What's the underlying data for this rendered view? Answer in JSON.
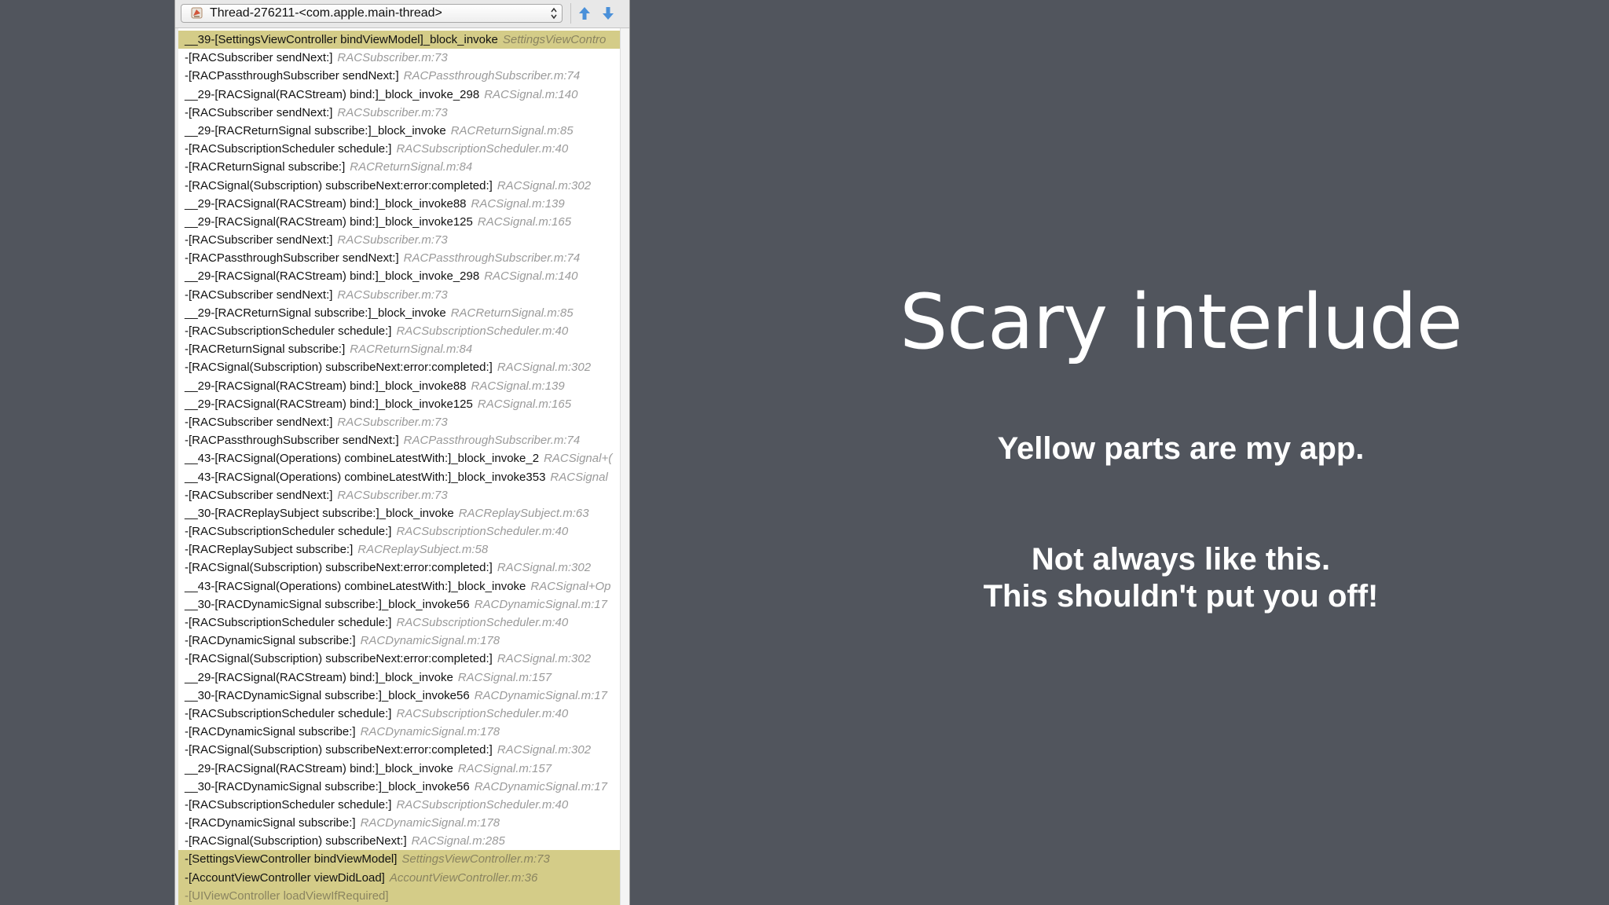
{
  "debugger": {
    "thread_label": "Thread-276211-<com.apple.main-thread>",
    "frames": [
      {
        "fn": "__39-[SettingsViewController bindViewModel]_block_invoke",
        "loc": "SettingsViewContro",
        "app": true
      },
      {
        "fn": "-[RACSubscriber sendNext:]",
        "loc": "RACSubscriber.m:73",
        "app": false
      },
      {
        "fn": "-[RACPassthroughSubscriber sendNext:]",
        "loc": "RACPassthroughSubscriber.m:74",
        "app": false
      },
      {
        "fn": "__29-[RACSignal(RACStream) bind:]_block_invoke_298",
        "loc": "RACSignal.m:140",
        "app": false
      },
      {
        "fn": "-[RACSubscriber sendNext:]",
        "loc": "RACSubscriber.m:73",
        "app": false
      },
      {
        "fn": "__29-[RACReturnSignal subscribe:]_block_invoke",
        "loc": "RACReturnSignal.m:85",
        "app": false
      },
      {
        "fn": "-[RACSubscriptionScheduler schedule:]",
        "loc": "RACSubscriptionScheduler.m:40",
        "app": false
      },
      {
        "fn": "-[RACReturnSignal subscribe:]",
        "loc": "RACReturnSignal.m:84",
        "app": false
      },
      {
        "fn": "-[RACSignal(Subscription) subscribeNext:error:completed:]",
        "loc": "RACSignal.m:302",
        "app": false
      },
      {
        "fn": "__29-[RACSignal(RACStream) bind:]_block_invoke88",
        "loc": "RACSignal.m:139",
        "app": false
      },
      {
        "fn": "__29-[RACSignal(RACStream) bind:]_block_invoke125",
        "loc": "RACSignal.m:165",
        "app": false
      },
      {
        "fn": "-[RACSubscriber sendNext:]",
        "loc": "RACSubscriber.m:73",
        "app": false
      },
      {
        "fn": "-[RACPassthroughSubscriber sendNext:]",
        "loc": "RACPassthroughSubscriber.m:74",
        "app": false
      },
      {
        "fn": "__29-[RACSignal(RACStream) bind:]_block_invoke_298",
        "loc": "RACSignal.m:140",
        "app": false
      },
      {
        "fn": "-[RACSubscriber sendNext:]",
        "loc": "RACSubscriber.m:73",
        "app": false
      },
      {
        "fn": "__29-[RACReturnSignal subscribe:]_block_invoke",
        "loc": "RACReturnSignal.m:85",
        "app": false
      },
      {
        "fn": "-[RACSubscriptionScheduler schedule:]",
        "loc": "RACSubscriptionScheduler.m:40",
        "app": false
      },
      {
        "fn": "-[RACReturnSignal subscribe:]",
        "loc": "RACReturnSignal.m:84",
        "app": false
      },
      {
        "fn": "-[RACSignal(Subscription) subscribeNext:error:completed:]",
        "loc": "RACSignal.m:302",
        "app": false
      },
      {
        "fn": "__29-[RACSignal(RACStream) bind:]_block_invoke88",
        "loc": "RACSignal.m:139",
        "app": false
      },
      {
        "fn": "__29-[RACSignal(RACStream) bind:]_block_invoke125",
        "loc": "RACSignal.m:165",
        "app": false
      },
      {
        "fn": "-[RACSubscriber sendNext:]",
        "loc": "RACSubscriber.m:73",
        "app": false
      },
      {
        "fn": "-[RACPassthroughSubscriber sendNext:]",
        "loc": "RACPassthroughSubscriber.m:74",
        "app": false
      },
      {
        "fn": "__43-[RACSignal(Operations) combineLatestWith:]_block_invoke_2",
        "loc": "RACSignal+(",
        "app": false
      },
      {
        "fn": "__43-[RACSignal(Operations) combineLatestWith:]_block_invoke353",
        "loc": "RACSignal",
        "app": false
      },
      {
        "fn": "-[RACSubscriber sendNext:]",
        "loc": "RACSubscriber.m:73",
        "app": false
      },
      {
        "fn": "__30-[RACReplaySubject subscribe:]_block_invoke",
        "loc": "RACReplaySubject.m:63",
        "app": false
      },
      {
        "fn": "-[RACSubscriptionScheduler schedule:]",
        "loc": "RACSubscriptionScheduler.m:40",
        "app": false
      },
      {
        "fn": "-[RACReplaySubject subscribe:]",
        "loc": "RACReplaySubject.m:58",
        "app": false
      },
      {
        "fn": "-[RACSignal(Subscription) subscribeNext:error:completed:]",
        "loc": "RACSignal.m:302",
        "app": false
      },
      {
        "fn": "__43-[RACSignal(Operations) combineLatestWith:]_block_invoke",
        "loc": "RACSignal+Op",
        "app": false
      },
      {
        "fn": "__30-[RACDynamicSignal subscribe:]_block_invoke56",
        "loc": "RACDynamicSignal.m:17",
        "app": false
      },
      {
        "fn": "-[RACSubscriptionScheduler schedule:]",
        "loc": "RACSubscriptionScheduler.m:40",
        "app": false
      },
      {
        "fn": "-[RACDynamicSignal subscribe:]",
        "loc": "RACDynamicSignal.m:178",
        "app": false
      },
      {
        "fn": "-[RACSignal(Subscription) subscribeNext:error:completed:]",
        "loc": "RACSignal.m:302",
        "app": false
      },
      {
        "fn": "__29-[RACSignal(RACStream) bind:]_block_invoke",
        "loc": "RACSignal.m:157",
        "app": false
      },
      {
        "fn": "__30-[RACDynamicSignal subscribe:]_block_invoke56",
        "loc": "RACDynamicSignal.m:17",
        "app": false
      },
      {
        "fn": "-[RACSubscriptionScheduler schedule:]",
        "loc": "RACSubscriptionScheduler.m:40",
        "app": false
      },
      {
        "fn": "-[RACDynamicSignal subscribe:]",
        "loc": "RACDynamicSignal.m:178",
        "app": false
      },
      {
        "fn": "-[RACSignal(Subscription) subscribeNext:error:completed:]",
        "loc": "RACSignal.m:302",
        "app": false
      },
      {
        "fn": "__29-[RACSignal(RACStream) bind:]_block_invoke",
        "loc": "RACSignal.m:157",
        "app": false
      },
      {
        "fn": "__30-[RACDynamicSignal subscribe:]_block_invoke56",
        "loc": "RACDynamicSignal.m:17",
        "app": false
      },
      {
        "fn": "-[RACSubscriptionScheduler schedule:]",
        "loc": "RACSubscriptionScheduler.m:40",
        "app": false
      },
      {
        "fn": "-[RACDynamicSignal subscribe:]",
        "loc": "RACDynamicSignal.m:178",
        "app": false
      },
      {
        "fn": "-[RACSignal(Subscription) subscribeNext:]",
        "loc": "RACSignal.m:285",
        "app": false
      },
      {
        "fn": "-[SettingsViewController bindViewModel]",
        "loc": "SettingsViewController.m:73",
        "app": true
      },
      {
        "fn": "-[AccountViewController viewDidLoad]",
        "loc": "AccountViewController.m:36",
        "app": true
      },
      {
        "fn": "-[UIViewController loadViewIfRequired]",
        "loc": "",
        "app": true,
        "faded": true
      }
    ]
  },
  "slide": {
    "title": "Scary interlude",
    "line1": "Yellow parts are my app.",
    "line2": "Not always like this.",
    "line3": "This shouldn't put you off!"
  },
  "colors": {
    "background": "#51555d",
    "app_highlight": "#d4cc88",
    "nav_arrow": "#4a90d9"
  },
  "icons": {
    "thread": "thread-icon",
    "select_arrows": "updown-chevron-icon",
    "previous": "arrow-up-icon",
    "next": "arrow-down-icon"
  }
}
